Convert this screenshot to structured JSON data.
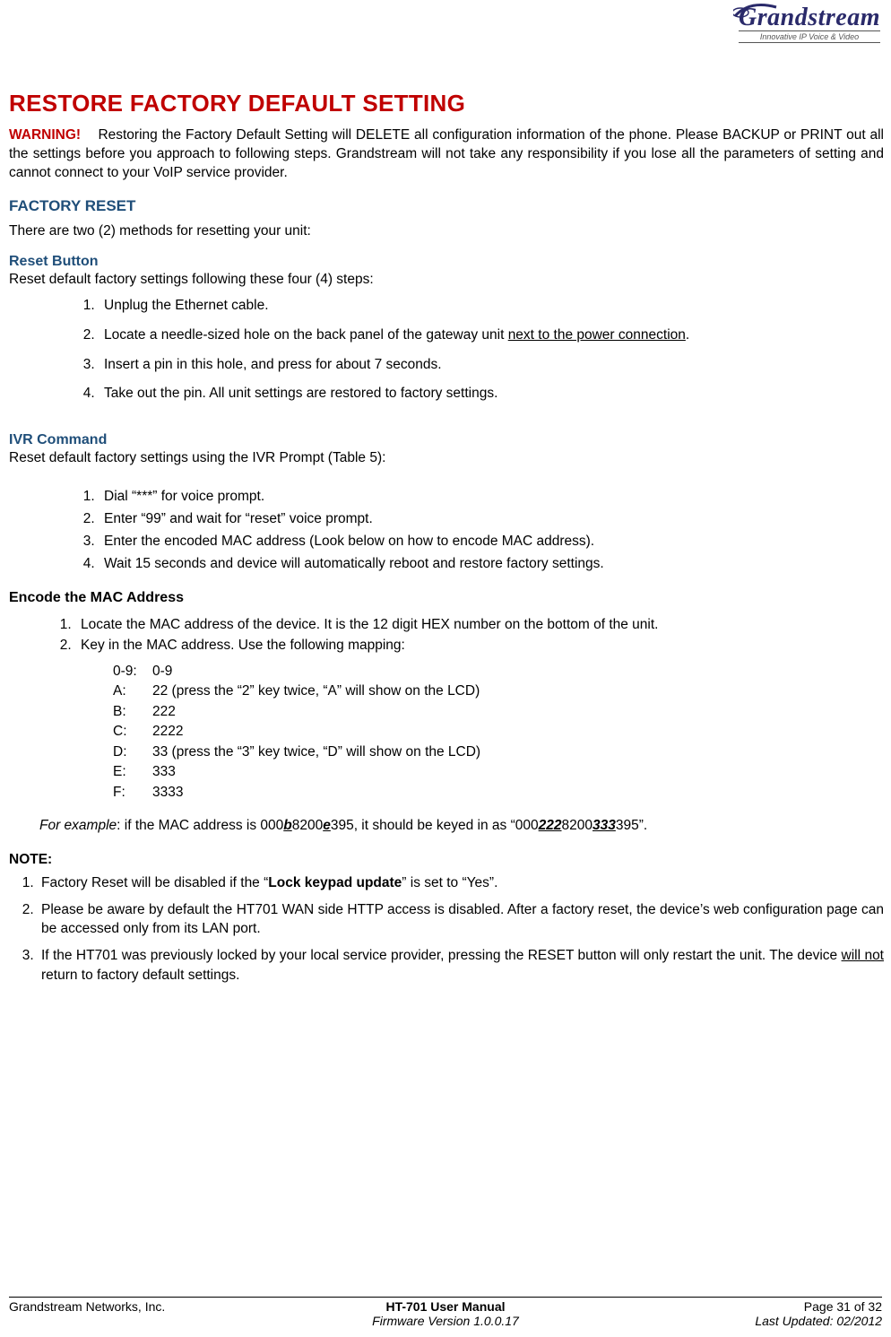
{
  "logo": {
    "brand": "Grandstream",
    "tagline": "Innovative IP Voice & Video"
  },
  "title": "RESTORE FACTORY DEFAULT SETTING",
  "warning": {
    "label": "WARNING!",
    "text": "Restoring the Factory Default Setting will DELETE all configuration information of the phone. Please BACKUP or PRINT out all the settings before you approach to following steps. Grandstream will not take any responsibility if you lose all the parameters of setting and cannot connect to your VoIP service provider."
  },
  "factory_reset": {
    "heading": "FACTORY RESET",
    "intro": "There are two (2) methods for resetting your unit:"
  },
  "reset_button": {
    "heading": "Reset Button",
    "intro": "Reset default factory settings following these four (4) steps:",
    "steps": [
      "Unplug the Ethernet cable.",
      "Locate a needle-sized hole on the back panel of the gateway unit ",
      "Insert a pin in this hole, and press for about 7 seconds.",
      "Take out the pin.  All unit settings are restored to factory settings."
    ],
    "step2_underline": "next to the power connection",
    "step2_tail": "."
  },
  "ivr": {
    "heading": "IVR Command",
    "intro": "Reset default factory settings using the IVR Prompt (Table 5):",
    "steps": [
      "Dial “***” for voice prompt.",
      "Enter “99” and wait for “reset” voice prompt.",
      "Enter the encoded MAC address (Look below on how to encode MAC address).",
      "Wait 15 seconds and device will automatically reboot and restore factory settings."
    ]
  },
  "encode": {
    "heading": "Encode the MAC Address",
    "steps": [
      "Locate the MAC address of the device.  It is the 12 digit HEX number on the bottom of the unit.",
      "Key in the MAC address.  Use the following mapping:"
    ],
    "mapping": [
      {
        "k": "0-9:",
        "v": "0-9"
      },
      {
        "k": "A:",
        "v": "22  (press the “2” key twice, “A” will show on the LCD)"
      },
      {
        "k": "B:",
        "v": "222"
      },
      {
        "k": "C:",
        "v": "2222"
      },
      {
        "k": "D:",
        "v": "33  (press the “3” key twice, “D” will show on the LCD)"
      },
      {
        "k": "E:",
        "v": "333"
      },
      {
        "k": "F:",
        "v": "3333"
      }
    ],
    "example": {
      "label": "For example",
      "pre": ":  if the MAC address is 000",
      "b": "b",
      "mid1": "8200",
      "e": "e",
      "mid2": "395, it should be keyed in as “000",
      "r222": "222",
      "mid3": "8200",
      "r333": "333",
      "tail": "395”."
    }
  },
  "note": {
    "heading": "NOTE:",
    "n1_pre": "Factory Reset will be disabled if the “",
    "n1_bold": "Lock keypad update",
    "n1_post": "” is set to “Yes”.",
    "n2": "Please be aware by default the HT701 WAN side HTTP access is disabled. After a factory reset, the device’s web configuration page can be accessed only from its LAN port.",
    "n3_pre": "If the HT701 was previously locked by your local service provider, pressing the RESET button will only restart the unit.  The device ",
    "n3_under": "will not",
    "n3_post": " return to factory default settings."
  },
  "footer": {
    "company": "Grandstream Networks, Inc.",
    "manual": "HT-701 User Manual",
    "firmware": "Firmware Version 1.0.0.17",
    "page": "Page 31 of 32",
    "updated": "Last Updated: 02/2012"
  }
}
